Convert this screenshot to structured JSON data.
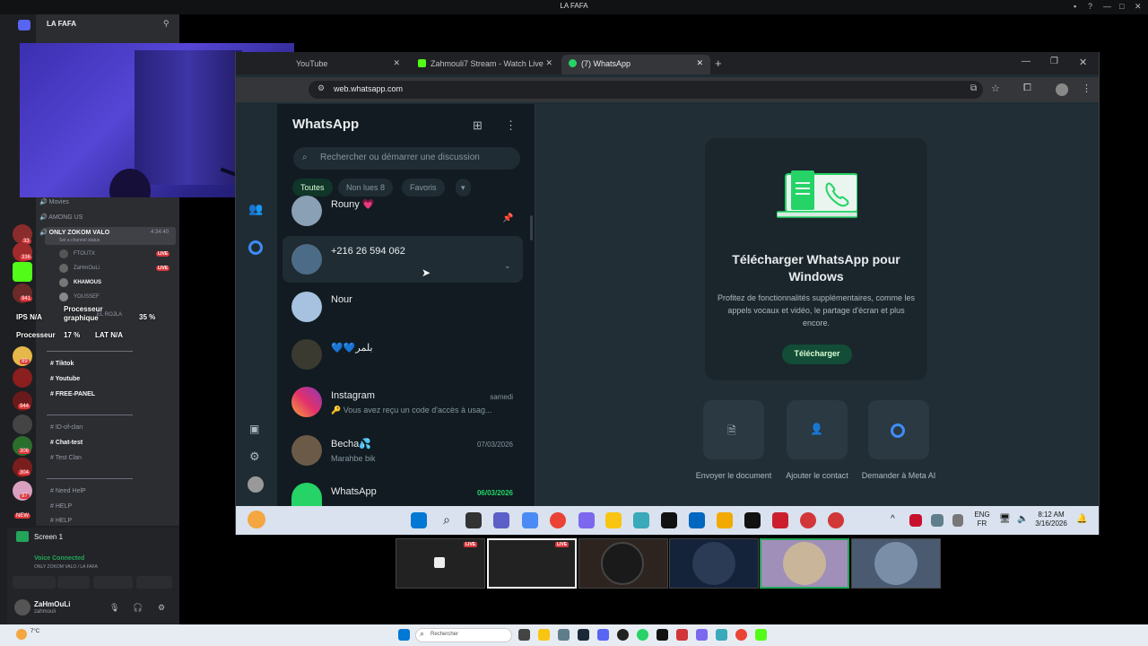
{
  "discord": {
    "window_title": "LA FAFA",
    "server_name": "LA FAFA",
    "channels": [
      {
        "label": "Movies"
      },
      {
        "label": "AMONG US"
      },
      {
        "label": "ONLY ZOKOM VALO",
        "time": "4:34:40",
        "status": "Set a channel status"
      },
      {
        "label": "FTOUTX"
      },
      {
        "label": "ZaHmOuLi"
      },
      {
        "label": "KHAMOUS"
      },
      {
        "label": "YOUSSEF"
      },
      {
        "label": "EL ROJLA"
      },
      {
        "label": "Tiktok"
      },
      {
        "label": "Youtube"
      },
      {
        "label": "FREE-PANEL"
      },
      {
        "label": "ID-of-clan"
      },
      {
        "label": "Chat-test"
      },
      {
        "label": "Test Clan"
      },
      {
        "label": "Need HelP"
      },
      {
        "label": "HELP"
      },
      {
        "label": "HELP"
      }
    ],
    "live_label": "LIVE",
    "new_label": "NEW",
    "screen_label": "Screen 1",
    "voice_status": "Voice Connected",
    "voice_channel": "ONLY ZOKOM VALO / LA FAFA",
    "user_name": "ZaHmOuLi",
    "user_handle": "zahmouli",
    "guild_badges": [
      "33",
      "336",
      "41",
      "941",
      "89",
      "944",
      "306",
      "304",
      "97"
    ]
  },
  "stats": {
    "ips_label": "IPS",
    "ips_value": "N/A",
    "gpu_label": "Processeur graphique",
    "gpu_value": "35 %",
    "cpu_label": "Processeur",
    "cpu_value": "17 %",
    "lat_label": "LAT",
    "lat_value": "N/A"
  },
  "browser": {
    "tabs": [
      {
        "label": "YouTube",
        "color": "#ff0000"
      },
      {
        "label": "Zahmouli7 Stream - Watch Live",
        "color": "#53fc18"
      },
      {
        "label": "(7) WhatsApp",
        "color": "#25d366"
      }
    ],
    "url": "web.whatsapp.com"
  },
  "whatsapp": {
    "title": "WhatsApp",
    "search_placeholder": "Rechercher ou démarrer une discussion",
    "filters": [
      "Toutes",
      "Non lues 8",
      "Favoris"
    ],
    "chats": [
      {
        "name": "Rouny 💗",
        "msg": "",
        "time": ""
      },
      {
        "name": "+216 26 594 062",
        "msg": "",
        "time": ""
      },
      {
        "name": "Nour",
        "msg": "",
        "time": ""
      },
      {
        "name": "💙💙بلمر",
        "msg": "",
        "time": ""
      },
      {
        "name": "Instagram",
        "msg": "🔑 Vous avez reçu un code d'accès à usag...",
        "time": "samedi"
      },
      {
        "name": "Becha💦",
        "msg": "Marahbe bik",
        "time": "07/03/2026"
      },
      {
        "name": "WhatsApp",
        "msg": "",
        "time": "06/03/2026"
      }
    ],
    "download_title": "Télécharger WhatsApp pour Windows",
    "download_desc": "Profitez de fonctionnalités supplémentaires, comme les appels vocaux et vidéo, le partage d'écran et plus encore.",
    "download_button": "Télécharger",
    "quick_actions": [
      "Envoyer le document",
      "Ajouter le contact",
      "Demander à Meta AI"
    ]
  },
  "taskbar": {
    "lang_top": "ENG",
    "lang_bottom": "FR",
    "time": "8:12 AM",
    "date": "3/16/2026"
  },
  "os_taskbar": {
    "search_placeholder": "Rechercher",
    "weather": "7°C"
  }
}
